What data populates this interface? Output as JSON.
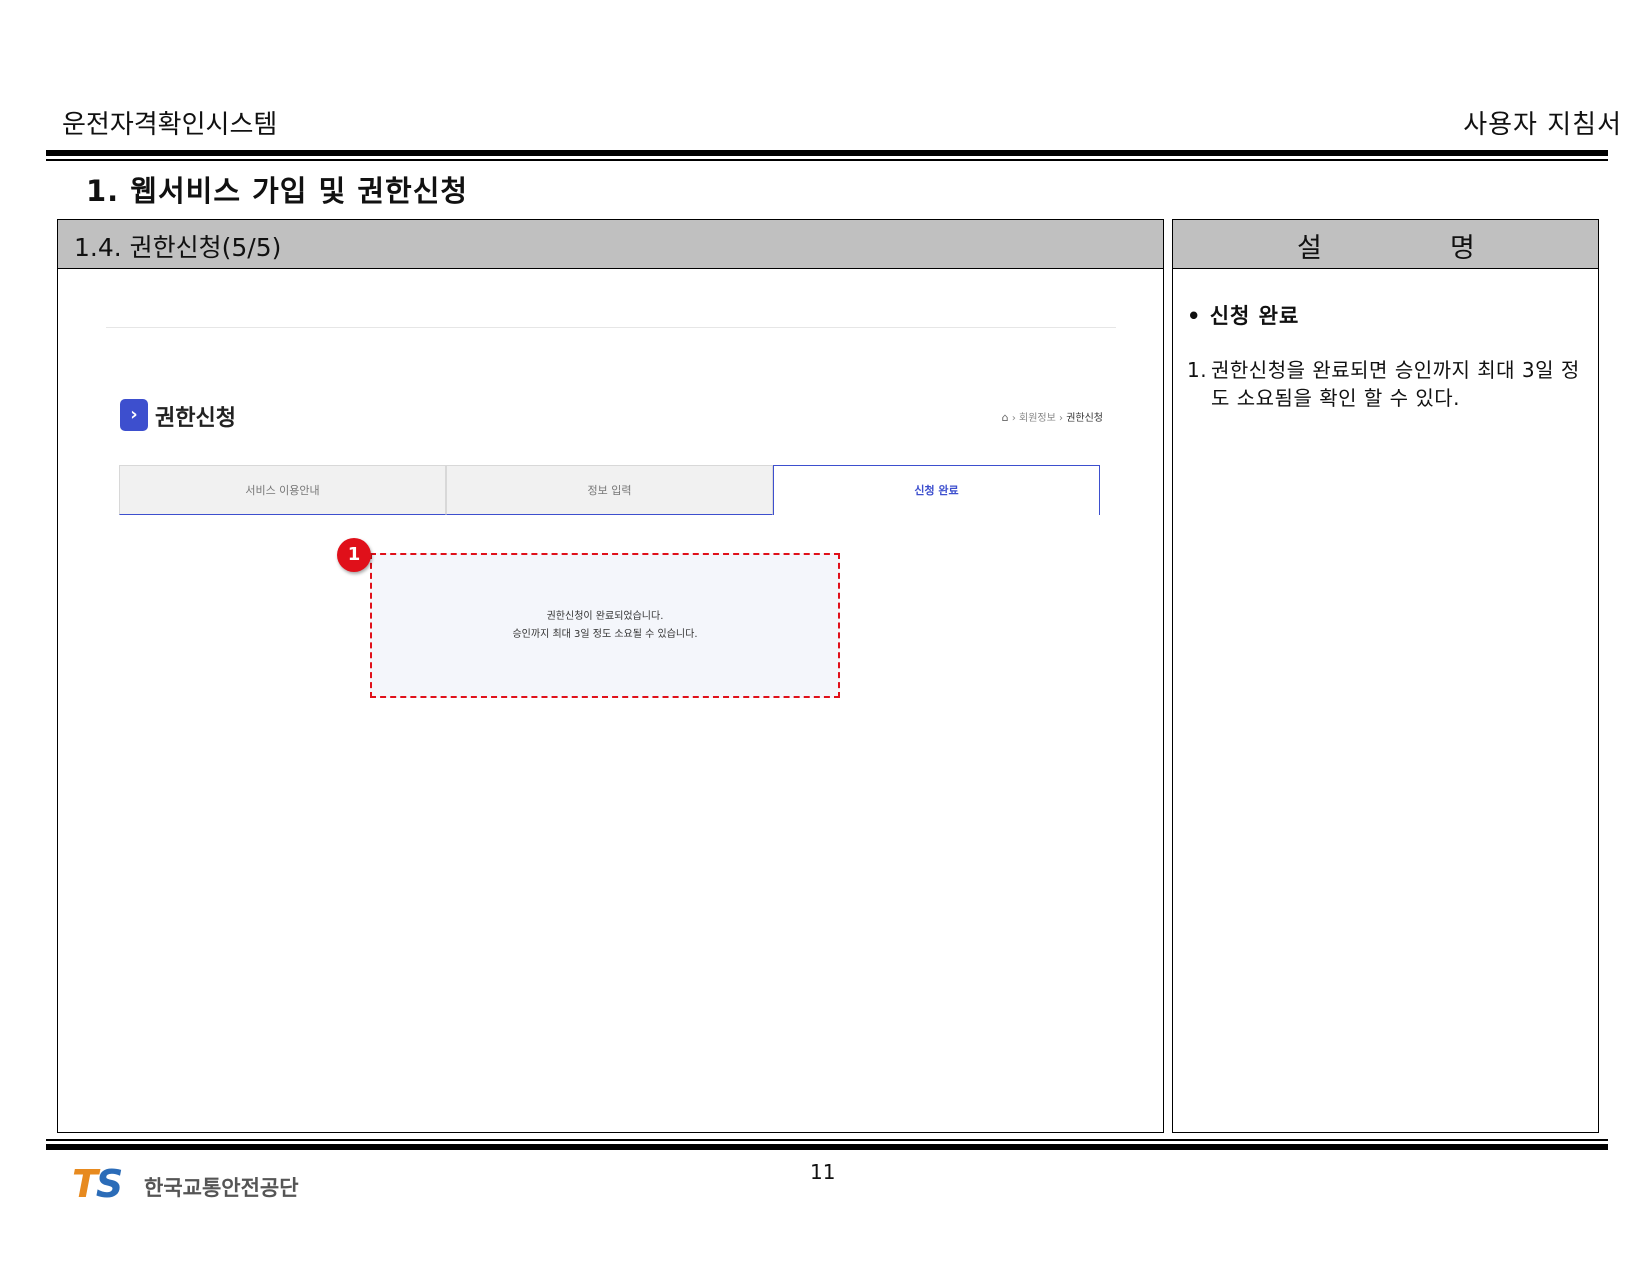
{
  "header": {
    "system_name": "운전자격확인시스템",
    "doc_type": "사용자 지침서"
  },
  "section": {
    "title": "1. 웹서비스 가입 및 권한신청"
  },
  "left_panel": {
    "title": "1.4. 권한신청(5/5)"
  },
  "screenshot": {
    "page_title": "권한신청",
    "breadcrumb": {
      "home_icon": "home-icon",
      "sep1": "›",
      "item1": "회원정보",
      "sep2": "›",
      "item2": "권한신청"
    },
    "steps": [
      {
        "label": "서비스 이용안내",
        "active": false
      },
      {
        "label": "정보 입력",
        "active": false
      },
      {
        "label": "신청 완료",
        "active": true
      }
    ],
    "complete_message": {
      "line1": "권한신청이 완료되었습니다.",
      "line2": "승인까지 최대 3일 정도 소요될 수 있습니다."
    },
    "marker": "1",
    "accent_color": "#3d4fce",
    "highlight_color": "#e0101a"
  },
  "right_panel": {
    "header_left": "설",
    "header_right": "명",
    "bullet": "• 신청 완료",
    "item_number": "1.",
    "item_text": "권한신청을 완료되면 승인까지 최대 3일 정도 소요됨을 확인 할 수 있다."
  },
  "footer": {
    "logo_mark_t": "T",
    "logo_mark_s": "S",
    "logo_text": "한국교통안전공단",
    "page_number": "11"
  }
}
